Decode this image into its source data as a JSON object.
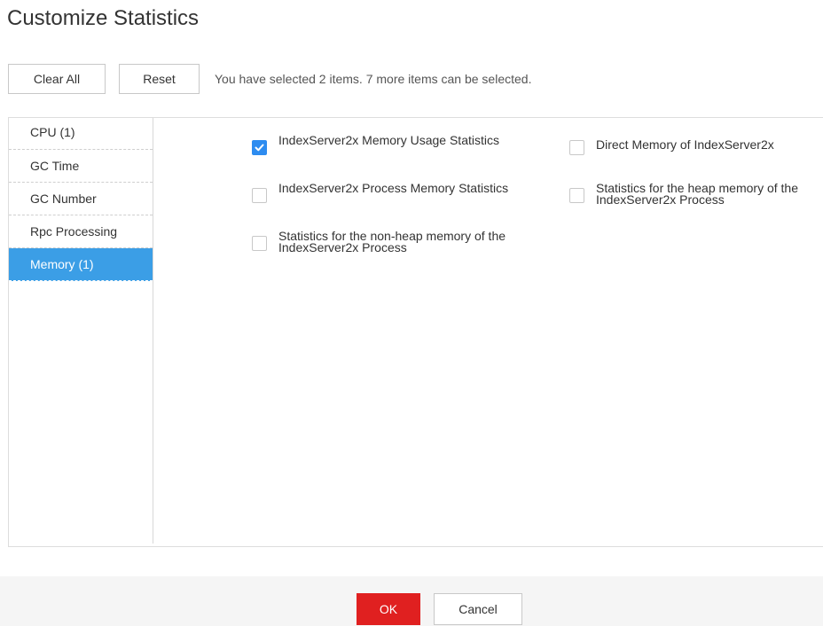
{
  "dialog": {
    "title": "Customize Statistics"
  },
  "toolbar": {
    "clear_all_label": "Clear All",
    "reset_label": "Reset",
    "selection_info": "You have selected 2 items. 7 more items can be selected."
  },
  "categories": [
    {
      "label": "CPU (1)",
      "active": false
    },
    {
      "label": "GC Time",
      "active": false
    },
    {
      "label": "GC Number",
      "active": false
    },
    {
      "label": "Rpc Processing",
      "active": false
    },
    {
      "label": "Memory (1)",
      "active": true
    }
  ],
  "options": [
    {
      "label": "IndexServer2x Memory Usage Statistics",
      "checked": true
    },
    {
      "label": "Direct Memory of IndexServer2x",
      "checked": false
    },
    {
      "label": "IndexServer2x Process Memory Statistics",
      "checked": false
    },
    {
      "label": "Statistics for the heap memory of the IndexServer2x Process",
      "checked": false
    },
    {
      "label": "Statistics for the non-heap memory of the IndexServer2x Process",
      "checked": false
    }
  ],
  "footer": {
    "ok_label": "OK",
    "cancel_label": "Cancel"
  },
  "colors": {
    "active_category": "#3b9ee6",
    "checkbox_checked": "#2d8cf0",
    "ok_button": "#e02020"
  }
}
